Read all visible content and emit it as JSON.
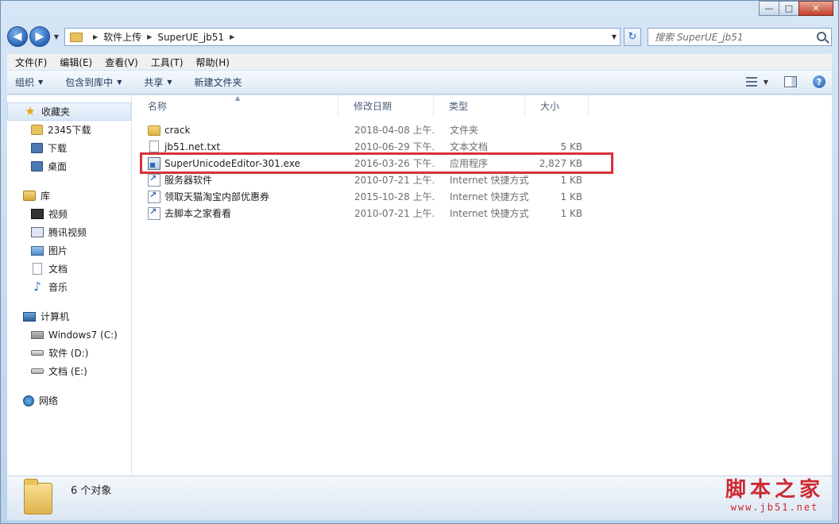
{
  "window": {
    "minimize_label": "—",
    "maximize_label": "□",
    "close_label": "✕"
  },
  "nav": {
    "back_glyph": "◀",
    "forward_glyph": "▶",
    "dropdown_glyph": "▼",
    "breadcrumb_sep": "▶",
    "breadcrumbs": [
      "软件上传",
      "SuperUE_jb51"
    ],
    "refresh_glyph": "↻",
    "search_placeholder": "搜索 SuperUE_jb51"
  },
  "menubar": {
    "items": [
      "文件(F)",
      "编辑(E)",
      "查看(V)",
      "工具(T)",
      "帮助(H)"
    ]
  },
  "commandbar": {
    "organize": "组织",
    "include_in_library": "包含到库中",
    "share": "共享",
    "new_folder": "新建文件夹",
    "dropdown_glyph": "▼",
    "help_glyph": "?"
  },
  "sidebar": {
    "favorites": {
      "header": "收藏夹",
      "items": [
        "2345下载",
        "下载",
        "桌面"
      ]
    },
    "libraries": {
      "header": "库",
      "items": [
        "视频",
        "腾讯视频",
        "图片",
        "文档",
        "音乐"
      ]
    },
    "computer": {
      "header": "计算机",
      "items": [
        "Windows7 (C:)",
        "软件 (D:)",
        "文档 (E:)"
      ]
    },
    "network": {
      "header": "网络"
    }
  },
  "columns": {
    "name": "名称",
    "date": "修改日期",
    "type": "类型",
    "size": "大小",
    "sort_glyph": "▲"
  },
  "files": [
    {
      "name": "crack",
      "date": "2018-04-08 上午...",
      "type": "文件夹",
      "size": "",
      "icon": "folder-icon"
    },
    {
      "name": "jb51.net.txt",
      "date": "2010-06-29 下午...",
      "type": "文本文档",
      "size": "5 KB",
      "icon": "text-file-icon"
    },
    {
      "name": "SuperUnicodeEditor-301.exe",
      "date": "2016-03-26 下午...",
      "type": "应用程序",
      "size": "2,827 KB",
      "icon": "exe-file-icon"
    },
    {
      "name": "服务器软件",
      "date": "2010-07-21 上午...",
      "type": "Internet 快捷方式",
      "size": "1 KB",
      "icon": "url-shortcut-icon"
    },
    {
      "name": "领取天猫淘宝内部优惠券",
      "date": "2015-10-28 上午...",
      "type": "Internet 快捷方式",
      "size": "1 KB",
      "icon": "url-shortcut-icon"
    },
    {
      "name": "去脚本之家看看",
      "date": "2010-07-21 上午...",
      "type": "Internet 快捷方式",
      "size": "1 KB",
      "icon": "url-shortcut-icon"
    }
  ],
  "details": {
    "count_text": "6 个对象"
  },
  "watermark": {
    "main": "脚本之家",
    "sub": "www.jb51.net"
  },
  "colors": {
    "highlight_border": "#d6323a",
    "watermark": "#cc2a33"
  }
}
